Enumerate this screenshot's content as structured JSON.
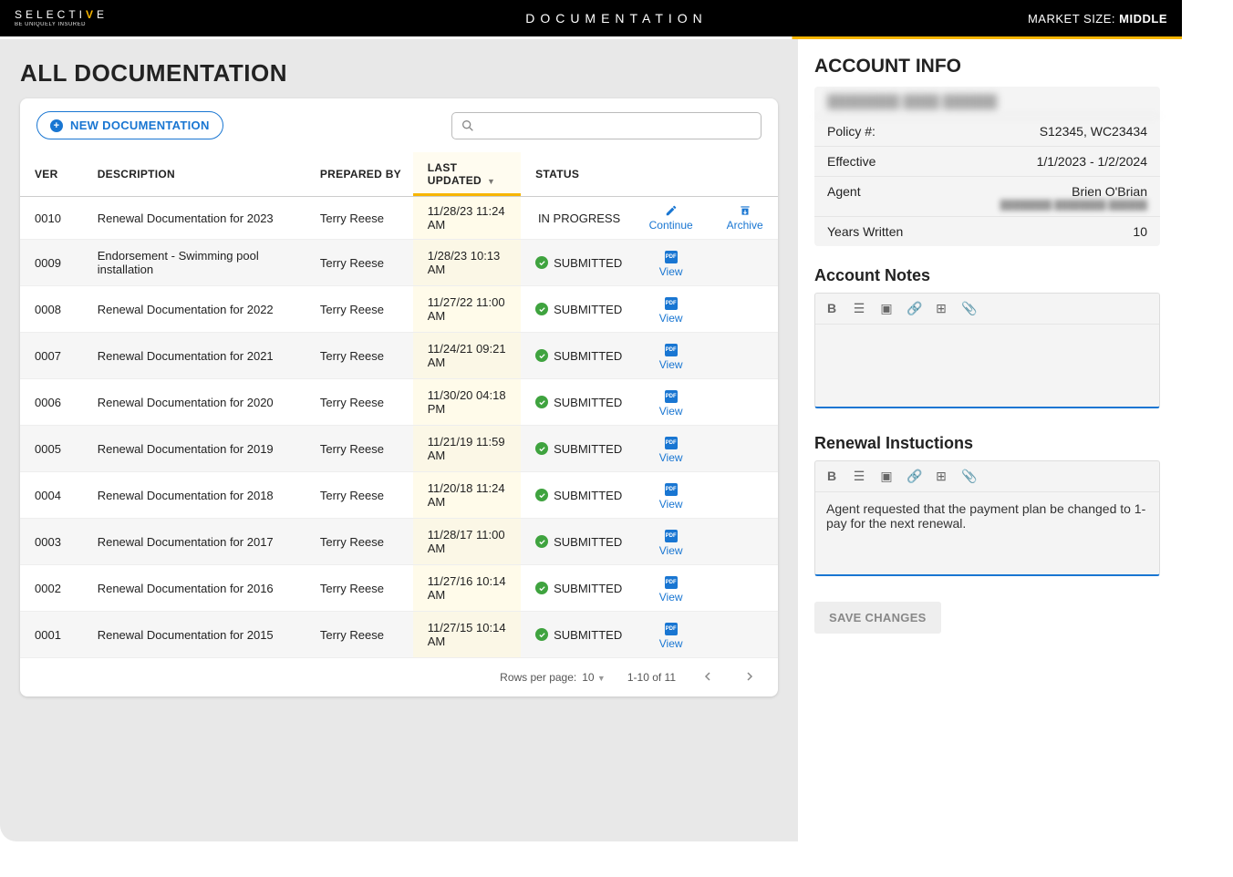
{
  "header": {
    "app_title": "DOCUMENTATION",
    "market_size_label": "MARKET SIZE:",
    "market_size_value": "MIDDLE",
    "logo_tagline": "BE UNIQUELY INSURED"
  },
  "page": {
    "title": "ALL DOCUMENTATION",
    "new_doc_label": "NEW DOCUMENTATION",
    "search_placeholder": ""
  },
  "table": {
    "columns": {
      "ver": "VER",
      "description": "DESCRIPTION",
      "prepared_by": "PREPARED BY",
      "last_updated": "LAST UPDATED",
      "status": "STATUS"
    },
    "rows": [
      {
        "ver": "0010",
        "desc": "Renewal Documentation for 2023",
        "prep": "Terry Reese",
        "updated": "11/28/23 11:24 AM",
        "status": "IN PROGRESS",
        "actions": [
          "continue",
          "archive"
        ]
      },
      {
        "ver": "0009",
        "desc": "Endorsement - Swimming pool installation",
        "prep": "Terry Reese",
        "updated": "1/28/23 10:13 AM",
        "status": "SUBMITTED",
        "actions": [
          "view"
        ]
      },
      {
        "ver": "0008",
        "desc": "Renewal Documentation for 2022",
        "prep": "Terry Reese",
        "updated": "11/27/22 11:00 AM",
        "status": "SUBMITTED",
        "actions": [
          "view"
        ]
      },
      {
        "ver": "0007",
        "desc": "Renewal Documentation for 2021",
        "prep": "Terry Reese",
        "updated": "11/24/21 09:21 AM",
        "status": "SUBMITTED",
        "actions": [
          "view"
        ]
      },
      {
        "ver": "0006",
        "desc": "Renewal Documentation for 2020",
        "prep": "Terry Reese",
        "updated": "11/30/20 04:18 PM",
        "status": "SUBMITTED",
        "actions": [
          "view"
        ]
      },
      {
        "ver": "0005",
        "desc": "Renewal Documentation for 2019",
        "prep": "Terry Reese",
        "updated": "11/21/19 11:59 AM",
        "status": "SUBMITTED",
        "actions": [
          "view"
        ]
      },
      {
        "ver": "0004",
        "desc": "Renewal Documentation for 2018",
        "prep": "Terry Reese",
        "updated": "11/20/18 11:24 AM",
        "status": "SUBMITTED",
        "actions": [
          "view"
        ]
      },
      {
        "ver": "0003",
        "desc": "Renewal Documentation for 2017",
        "prep": "Terry Reese",
        "updated": "11/28/17 11:00 AM",
        "status": "SUBMITTED",
        "actions": [
          "view"
        ]
      },
      {
        "ver": "0002",
        "desc": "Renewal Documentation for 2016",
        "prep": "Terry Reese",
        "updated": "11/27/16 10:14 AM",
        "status": "SUBMITTED",
        "actions": [
          "view"
        ]
      },
      {
        "ver": "0001",
        "desc": "Renewal Documentation for 2015",
        "prep": "Terry Reese",
        "updated": "11/27/15 10:14 AM",
        "status": "SUBMITTED",
        "actions": [
          "view"
        ]
      }
    ],
    "action_labels": {
      "continue": "Continue",
      "archive": "Archive",
      "view": "View"
    },
    "pagination": {
      "rows_label": "Rows per page:",
      "rows_value": "10",
      "range": "1-10 of 11"
    }
  },
  "account": {
    "title": "ACCOUNT INFO",
    "name_redacted": "████████ ████ ██████",
    "policy_label": "Policy #:",
    "policy_value": "S12345, WC23434",
    "effective_label": "Effective",
    "effective_value": "1/1/2023 - 1/2/2024",
    "agent_label": "Agent",
    "agent_value": "Brien O'Brian",
    "agent_sub": "████████ ████████ ██████",
    "years_label": "Years Written",
    "years_value": "10"
  },
  "notes": {
    "account_notes_label": "Account Notes",
    "account_notes_text": "",
    "renewal_label": "Renewal Instuctions",
    "renewal_text": "Agent requested that the payment plan be changed to 1-pay for the next renewal."
  },
  "buttons": {
    "save": "SAVE CHANGES"
  }
}
